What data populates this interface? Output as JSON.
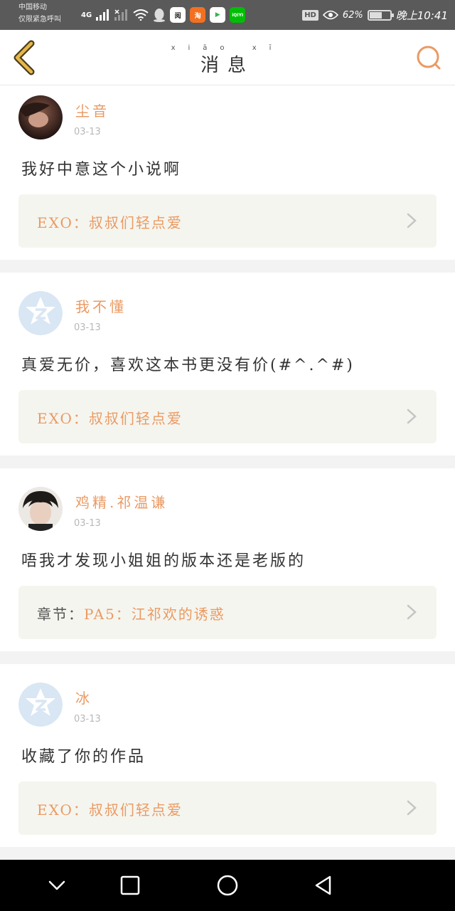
{
  "status_bar": {
    "carrier_line1": "中国移动",
    "carrier_line2": "仅限紧急呼叫",
    "network": "4G",
    "apps": [
      {
        "name": "yuewen-app-icon",
        "label": "阅",
        "bg": "#ffffff",
        "fg": "#222222"
      },
      {
        "name": "taobao-app-icon",
        "label": "淘",
        "bg": "#f37021",
        "fg": "#ffffff"
      },
      {
        "name": "play-app-icon",
        "label": "▶",
        "bg": "#ffffff",
        "fg": "#35b34a"
      },
      {
        "name": "iqiyi-app-icon",
        "label": "iQIYI",
        "bg": "#00be06",
        "fg": "#ffffff"
      }
    ],
    "hd": "HD",
    "battery": "62%",
    "battery_level": 0.62,
    "time": "晚上10:41"
  },
  "header": {
    "title_pinyin": "xiāo xī",
    "title": "消息"
  },
  "messages": [
    {
      "name": "尘音",
      "date": "03-13",
      "content": "我好中意这个小说啊",
      "book_prefix": "",
      "book": "EXO：叔叔们轻点爱"
    },
    {
      "name": "我不懂",
      "date": "03-13",
      "content": "真爱无价，喜欢这本书更没有价(#^.^#)",
      "book_prefix": "",
      "book": "EXO：叔叔们轻点爱"
    },
    {
      "name": "鸡精.祁温谦",
      "date": "03-13",
      "content": "唔我才发现小姐姐的版本还是老版的",
      "book_prefix": "章节：",
      "book": "PA5：江祁欢的诱惑"
    },
    {
      "name": "冰",
      "date": "03-13",
      "content": "收藏了你的作品",
      "book_prefix": "",
      "book": "EXO：叔叔们轻点爱"
    }
  ],
  "colors": {
    "accent": "#ea9a63",
    "title_text": "#333333",
    "book_card_bg": "#f5f5ef"
  }
}
